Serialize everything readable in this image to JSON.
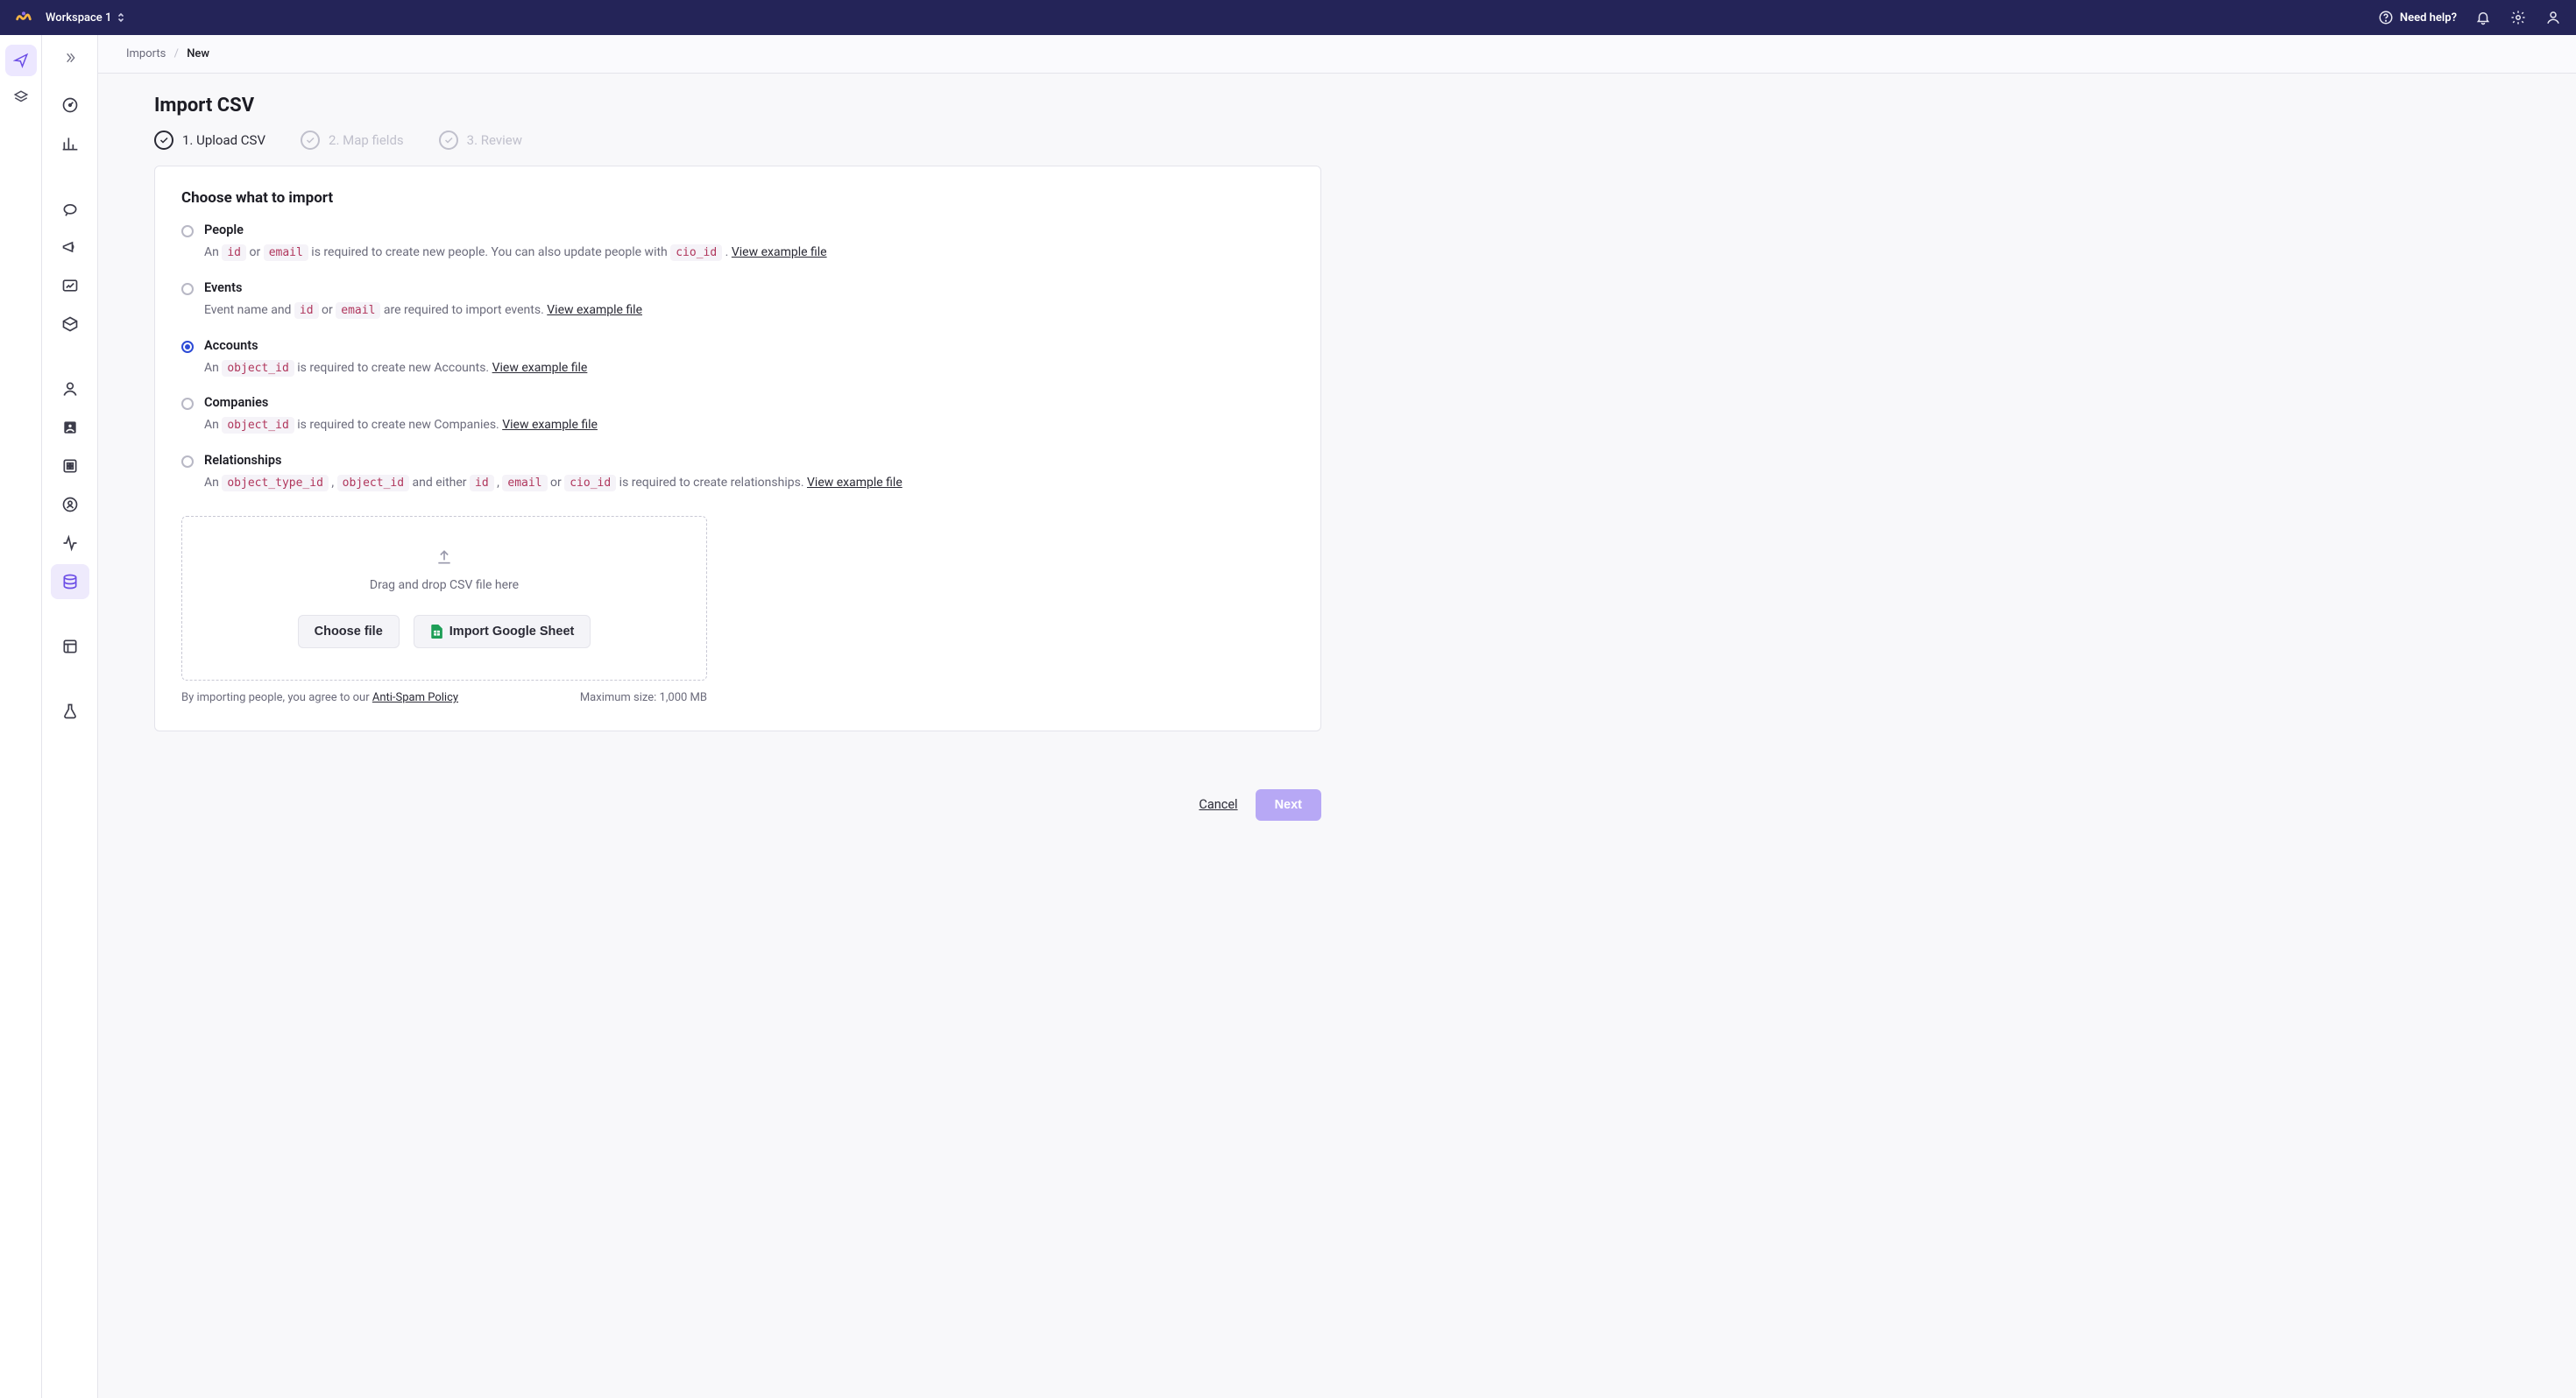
{
  "topbar": {
    "workspace_label": "Workspace 1",
    "help_label": "Need help?"
  },
  "breadcrumb": {
    "root": "Imports",
    "current": "New"
  },
  "page": {
    "title": "Import CSV"
  },
  "steps": [
    {
      "label": "1. Upload CSV",
      "active": true
    },
    {
      "label": "2. Map fields",
      "active": false
    },
    {
      "label": "3. Review",
      "active": false
    }
  ],
  "import_section": {
    "heading": "Choose what to import",
    "options": [
      {
        "key": "people",
        "label": "People",
        "selected": false,
        "desc_pre": "An ",
        "codes": [
          "id"
        ],
        "desc_mid1": " or ",
        "code2": "email",
        "desc_mid2": " is required to create new people. You can also update people with ",
        "code3": "cio_id",
        "desc_post": " . ",
        "link": "View example file"
      },
      {
        "key": "events",
        "label": "Events",
        "selected": false,
        "desc_pre": "Event name and ",
        "codes": [
          "id"
        ],
        "desc_mid1": " or ",
        "code2": "email",
        "desc_mid2": " are required to import events. ",
        "link": "View example file"
      },
      {
        "key": "accounts",
        "label": "Accounts",
        "selected": true,
        "desc_pre": "An ",
        "codes": [
          "object_id"
        ],
        "desc_mid2": " is required to create new Accounts. ",
        "link": "View example file"
      },
      {
        "key": "companies",
        "label": "Companies",
        "selected": false,
        "desc_pre": "An ",
        "codes": [
          "object_id"
        ],
        "desc_mid2": " is required to create new Companies. ",
        "link": "View example file"
      },
      {
        "key": "relationships",
        "label": "Relationships",
        "selected": false,
        "desc_pre": "An ",
        "codes": [
          "object_type_id"
        ],
        "desc_mid1": " , ",
        "code2": "object_id",
        "desc_mid2": " and either ",
        "code3": "id",
        "desc_mid3": " , ",
        "code4": "email",
        "desc_mid4": " or ",
        "code5": "cio_id",
        "desc_post": " is required to create relationships. ",
        "link": "View example file"
      }
    ]
  },
  "dropzone": {
    "text": "Drag and drop CSV file here",
    "choose_file": "Choose file",
    "import_gsheet": "Import Google Sheet"
  },
  "meta": {
    "agree_pre": "By importing people, you agree to our ",
    "agree_link": "Anti-Spam Policy",
    "max_size": "Maximum size: 1,000 MB"
  },
  "footer": {
    "cancel": "Cancel",
    "next": "Next"
  }
}
